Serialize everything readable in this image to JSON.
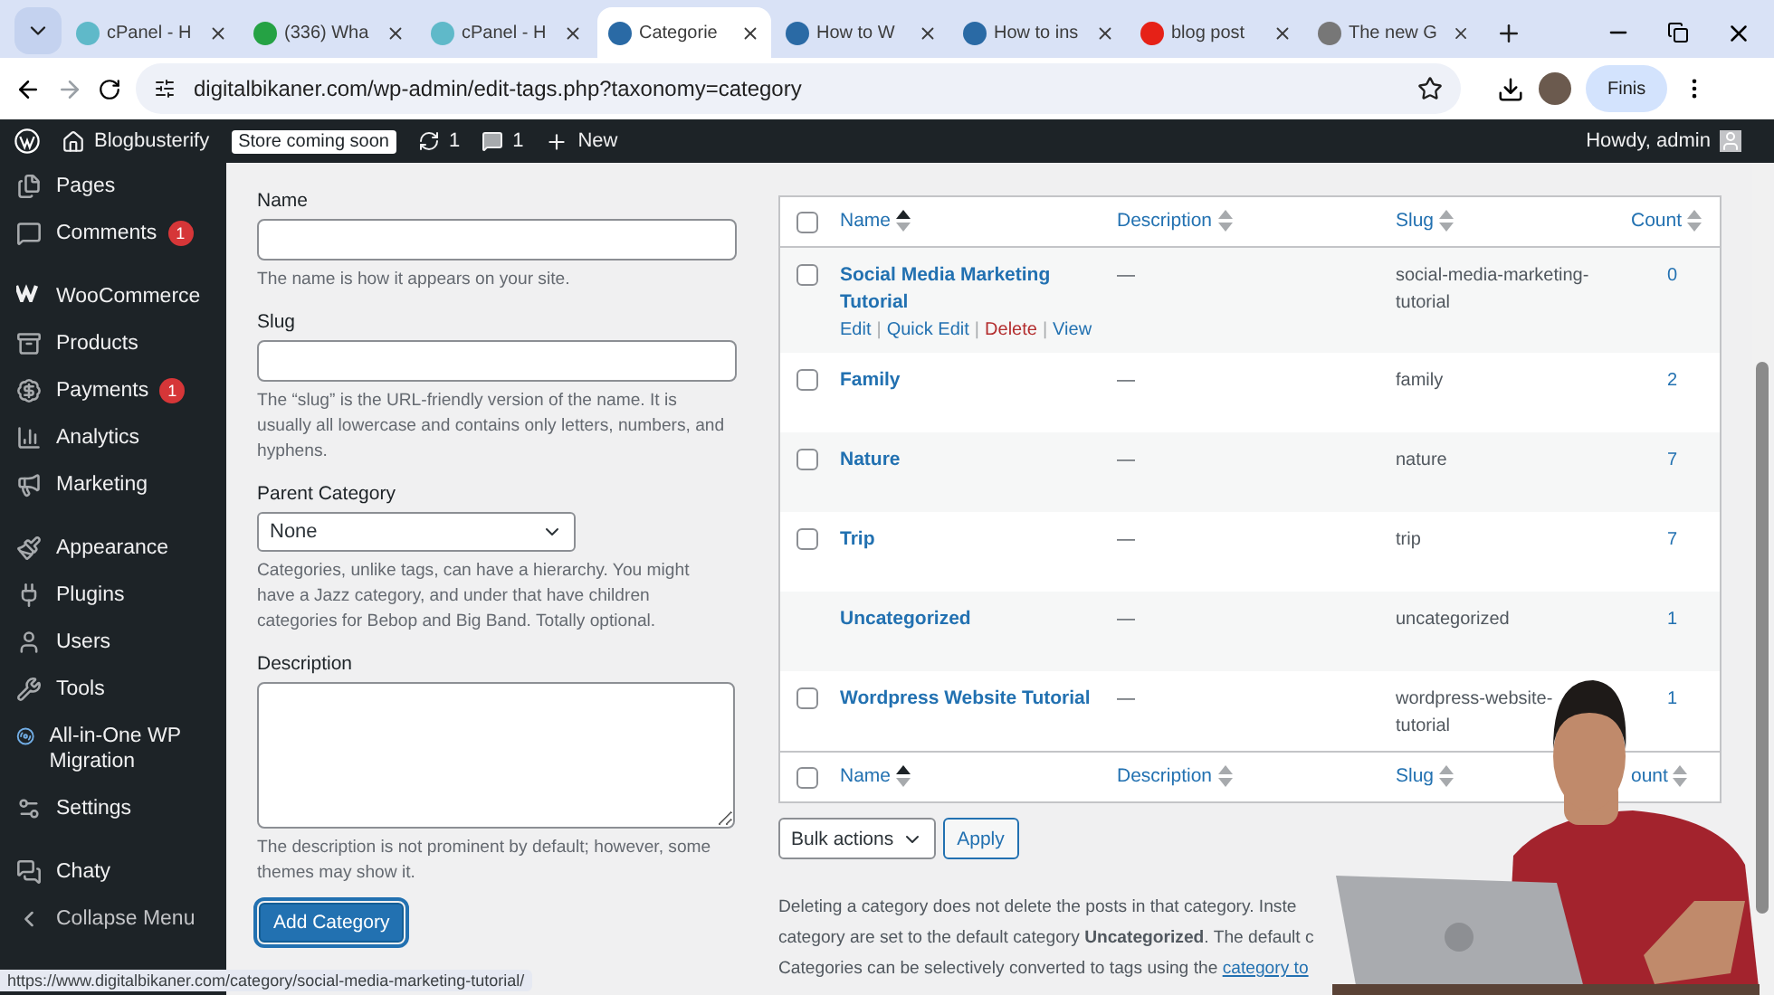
{
  "browser": {
    "tabs": [
      {
        "title": "cPanel - H",
        "kind": "cpanel",
        "selected": false
      },
      {
        "title": "(336) Wha",
        "kind": "chat",
        "selected": false
      },
      {
        "title": "cPanel - H",
        "kind": "cpanel",
        "selected": false
      },
      {
        "title": "Categorie",
        "kind": "wp",
        "selected": true
      },
      {
        "title": "How to W",
        "kind": "wp",
        "selected": false
      },
      {
        "title": "How to ins",
        "kind": "wp",
        "selected": false
      },
      {
        "title": "blog post",
        "kind": "video",
        "selected": false
      },
      {
        "title": "The new G",
        "kind": "wpgrey",
        "selected": false
      }
    ],
    "address": "digitalbikaner.com/wp-admin/edit-tags.php?taxonomy=category",
    "profile_button": "Finis"
  },
  "admin_bar": {
    "site": "Blogbusterify",
    "badge": "Store coming soon",
    "updates": "1",
    "comments": "1",
    "new": "New",
    "greeting": "Howdy, admin"
  },
  "sidebar": {
    "groups": [
      {
        "items": [
          {
            "label": "Pages",
            "kind": "pages"
          },
          {
            "label": "Comments",
            "kind": "comments",
            "badge": "1"
          }
        ]
      },
      {
        "items": [
          {
            "label": "WooCommerce",
            "kind": "woo"
          },
          {
            "label": "Products",
            "kind": "products"
          },
          {
            "label": "Payments",
            "kind": "payments",
            "badge": "1"
          },
          {
            "label": "Analytics",
            "kind": "analytics"
          },
          {
            "label": "Marketing",
            "kind": "marketing"
          }
        ]
      },
      {
        "items": [
          {
            "label": "Appearance",
            "kind": "appearance"
          },
          {
            "label": "Plugins",
            "kind": "plugins"
          },
          {
            "label": "Users",
            "kind": "users"
          },
          {
            "label": "Tools",
            "kind": "tools"
          },
          {
            "label": "All-in-One WP Migration",
            "kind": "migration"
          },
          {
            "label": "Settings",
            "kind": "settings"
          }
        ]
      },
      {
        "items": [
          {
            "label": "Chaty",
            "kind": "chaty"
          },
          {
            "label": "Collapse Menu",
            "kind": "collapse"
          }
        ]
      }
    ]
  },
  "form": {
    "fields": [
      {
        "label": "Name",
        "kind": "input",
        "hint": "The name is how it appears on your site."
      },
      {
        "label": "Slug",
        "kind": "input",
        "hint": "The “slug” is the URL-friendly version of the name. It is usually all lowercase and contains only letters, numbers, and hyphens."
      },
      {
        "label": "Parent Category",
        "kind": "select",
        "value": "None",
        "hint": "Categories, unlike tags, can have a hierarchy. You might have a Jazz category, and under that have children categories for Bebop and Big Band. Totally optional."
      },
      {
        "label": "Description",
        "kind": "textarea",
        "hint": "The description is not prominent by default; however, some themes may show it."
      }
    ],
    "submit": "Add Category"
  },
  "table": {
    "select_all_checked": false,
    "columns": [
      {
        "label": "Name",
        "sorted": true
      },
      {
        "label": "Description",
        "sorted": false
      },
      {
        "label": "Slug",
        "sorted": false
      },
      {
        "label": "Count",
        "sorted": false
      }
    ],
    "rows": [
      {
        "name": "Social Media Marketing Tutorial",
        "description": "—",
        "slug": "social-media-marketing-tutorial",
        "count": "0",
        "checked": false,
        "action_separator": "|",
        "actions": [
          {
            "label": "Edit",
            "kind": "link"
          },
          {
            "label": "Quick Edit",
            "kind": "link"
          },
          {
            "label": "Delete",
            "kind": "danger"
          },
          {
            "label": "View",
            "kind": "link"
          }
        ]
      },
      {
        "name": "Family",
        "description": "—",
        "slug": "family",
        "count": "2",
        "checked": false
      },
      {
        "name": "Nature",
        "description": "—",
        "slug": "nature",
        "count": "7",
        "checked": false
      },
      {
        "name": "Trip",
        "description": "—",
        "slug": "trip",
        "count": "7",
        "checked": false
      },
      {
        "name": "Uncategorized",
        "description": "—",
        "slug": "uncategorized",
        "count": "1"
      },
      {
        "name": "Wordpress Website Tutorial",
        "description": "—",
        "slug": "wordpress-website-\ntutorial",
        "count": "1",
        "checked": false
      }
    ],
    "footer_select_all_checked": false,
    "footer_columns": [
      {
        "label": "Name",
        "sorted": true
      },
      {
        "label": "Description",
        "sorted": false
      },
      {
        "label": "Slug",
        "sorted": false
      },
      {
        "label": "ount",
        "sorted": false
      }
    ]
  },
  "bulk": {
    "select": "Bulk actions",
    "apply": "Apply"
  },
  "notes": [
    {
      "text": "Deleting a category does not delete the posts in that category. Inste"
    },
    {
      "text": "category are set to the default category **Uncategorized**. The default c"
    },
    {
      "text": "Categories can be selectively converted to tags using the",
      "link": "category to"
    }
  ],
  "status_url": "https://www.digitalbikaner.com/category/social-media-marketing-tutorial/"
}
